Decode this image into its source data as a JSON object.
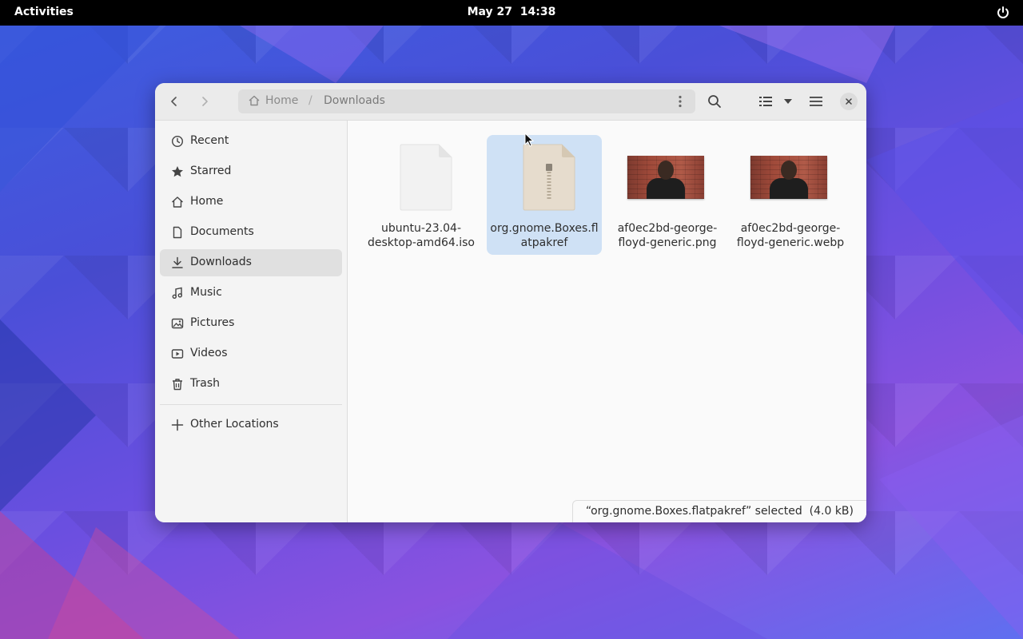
{
  "topbar": {
    "activities": "Activities",
    "date": "May 27",
    "time": "14:38"
  },
  "pathbar": {
    "home": "Home",
    "separator": "/",
    "current": "Downloads"
  },
  "sidebar": {
    "items": [
      {
        "label": "Recent",
        "icon": "clock-icon"
      },
      {
        "label": "Starred",
        "icon": "star-icon"
      },
      {
        "label": "Home",
        "icon": "home-icon"
      },
      {
        "label": "Documents",
        "icon": "document-icon"
      },
      {
        "label": "Downloads",
        "icon": "download-icon",
        "active": true
      },
      {
        "label": "Music",
        "icon": "music-icon"
      },
      {
        "label": "Pictures",
        "icon": "picture-icon"
      },
      {
        "label": "Videos",
        "icon": "video-icon"
      },
      {
        "label": "Trash",
        "icon": "trash-icon"
      }
    ],
    "other": "Other Locations"
  },
  "files": [
    {
      "name": "ubuntu-23.04-desktop-amd64.iso",
      "label_lines": [
        "ubuntu-23.04-",
        "desktop-amd64.iso"
      ],
      "type": "iso"
    },
    {
      "name": "org.gnome.Boxes.flatpakref",
      "label_lines": [
        "org.gnome.Boxes.fl",
        "atpakref"
      ],
      "type": "archive",
      "selected": true
    },
    {
      "name": "af0ec2bd-george-floyd-generic.png",
      "label_lines": [
        "af0ec2bd-george-",
        "floyd-generic.png"
      ],
      "type": "image"
    },
    {
      "name": "af0ec2bd-george-floyd-generic.webp",
      "label_lines": [
        "af0ec2bd-george-",
        "floyd-generic.webp"
      ],
      "type": "image"
    }
  ],
  "status": "“org.gnome.Boxes.flatpakref” selected  (4.0 kB)",
  "colors": {
    "selection": "#cfe1f5",
    "topbar": "#000000"
  }
}
